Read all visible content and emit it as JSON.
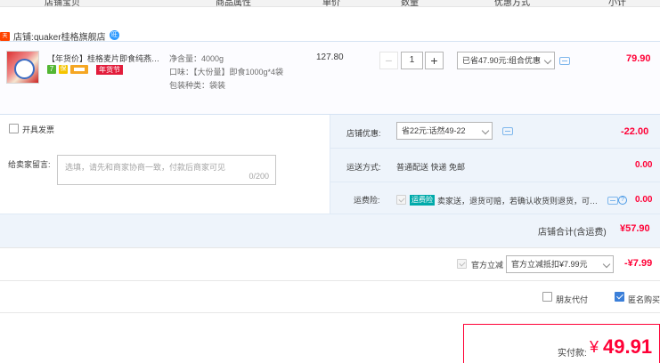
{
  "header": {
    "columns": [
      "店铺宝贝",
      "商品属性",
      "单价",
      "数量",
      "优惠方式",
      "小计"
    ]
  },
  "shop": {
    "badge": "天猫",
    "label": "店铺:",
    "name": "quaker桂格旗舰店",
    "ww_icon": "旺"
  },
  "item": {
    "title": "【年货价】桂格麦片即食纯燕麦片1000g*4袋",
    "icon_7": "7",
    "icon_b": "保",
    "festival_tag": "年货节",
    "attrs": {
      "net_weight": "净含量：4000g",
      "flavor": "口味：【大份量】即食1000g*4袋",
      "package": "包装种类：袋装"
    },
    "unit_price": "127.80",
    "quantity": "1",
    "minus": "−",
    "plus": "+",
    "discount_select": "已省47.90元:组合优惠",
    "subtotal": "79.90"
  },
  "shop_summary": {
    "invoice_label": "开具发票",
    "note_label": "给卖家留言:",
    "note_placeholder": "选填，请先和商家协商一致，付款后商家可见",
    "note_counter": "0/200",
    "shop_discount_label": "店铺优惠:",
    "shop_discount_select": "省22元:话然49-22",
    "shop_discount_value": "-22.00",
    "shipping_label": "运送方式:",
    "shipping_text": "普通配送 快递 免邮",
    "shipping_value": "0.00",
    "insurance_label": "运费险:",
    "insurance_badge": "运费险",
    "insurance_text": "卖家送，退货可赔，若确认收货则退货，可获...",
    "insurance_value": "0.00",
    "total_label": "店铺合计(含运费)",
    "total_value": "¥57.90"
  },
  "coupon": {
    "label": "官方立减",
    "select": "官方立减抵扣¥7.99元",
    "value": "-¥7.99"
  },
  "options": {
    "friend_pay": "朋友代付",
    "anonymous": "匿名购买"
  },
  "payment": {
    "label": "实付款:",
    "currency": "¥",
    "amount": "49.91"
  },
  "colors": {
    "accent_red": "#ff0036",
    "panel_blue": "#eef4fb",
    "checkbox_blue": "#3b7fd9"
  }
}
